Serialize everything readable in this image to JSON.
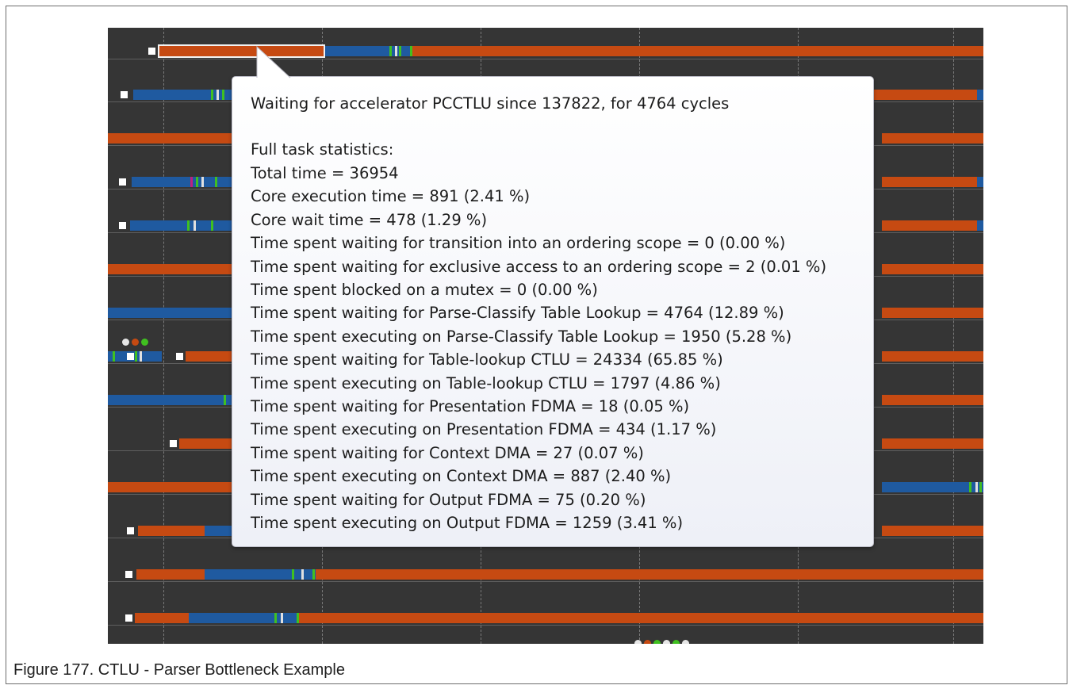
{
  "tooltip": {
    "header": "Waiting for accelerator PCCTLU since 137822, for 4764 cycles",
    "section_title": "Full task statistics:",
    "lines": [
      "Total time = 36954",
      "Core execution time = 891 (2.41 %)",
      "Core wait time = 478 (1.29 %)",
      "Time spent waiting for transition into an ordering scope = 0 (0.00 %)",
      "Time spent waiting for exclusive access to an ordering scope = 2 (0.01 %)",
      "Time spent blocked on a mutex = 0 (0.00 %)",
      "Time spent waiting for Parse-Classify Table Lookup = 4764 (12.89 %)",
      "Time spent executing on Parse-Classify Table Lookup = 1950 (5.28 %)",
      "Time spent waiting for Table-lookup CTLU = 24334 (65.85 %)",
      "Time spent executing on Table-lookup CTLU = 1797 (4.86 %)",
      "Time spent waiting for Presentation FDMA = 18 (0.05 %)",
      "Time spent executing on Presentation FDMA = 434 (1.17 %)",
      "Time spent waiting for Context DMA = 27 (0.07 %)",
      "Time spent executing on Context DMA = 887 (2.40 %)",
      "Time spent waiting for Output FDMA = 75 (0.20 %)",
      "Time spent executing on Output FDMA = 1259 (3.41 %)"
    ]
  },
  "caption": "Figure 177.  CTLU - Parser Bottleneck Example",
  "colors": {
    "background": "#353535",
    "wait": "#c64a12",
    "execute": "#1f5aa0",
    "accelerator_green": "#40c020",
    "accelerator_marker": "#e0e0e0"
  }
}
